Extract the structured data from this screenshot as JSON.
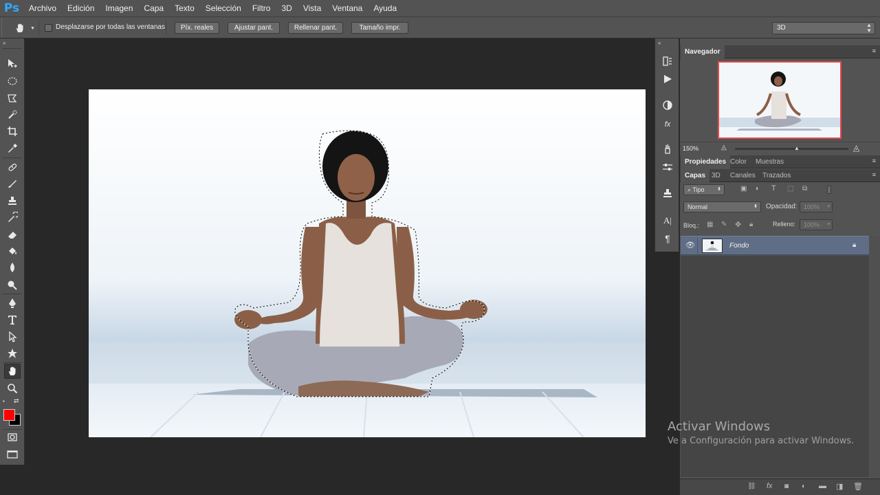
{
  "app": {
    "logo": "Ps"
  },
  "menu": [
    "Archivo",
    "Edición",
    "Imagen",
    "Capa",
    "Texto",
    "Selección",
    "Filtro",
    "3D",
    "Vista",
    "Ventana",
    "Ayuda"
  ],
  "options": {
    "scroll_all_label": "Desplazarse por todas las ventanas",
    "buttons": [
      "Píx. reales",
      "Ajustar pant.",
      "Rellenar pant.",
      "Tamaño impr."
    ],
    "workspace": "3D"
  },
  "tools": [
    "move-tool",
    "marquee-tool",
    "lasso-tool",
    "quick-selection-tool",
    "crop-tool",
    "eyedropper-tool",
    "healing-brush-tool",
    "brush-tool",
    "clone-stamp-tool",
    "history-brush-tool",
    "eraser-tool",
    "paint-bucket-tool",
    "blur-tool",
    "dodge-tool",
    "pen-tool",
    "type-tool",
    "path-selection-tool",
    "custom-shape-tool",
    "hand-tool",
    "zoom-tool"
  ],
  "colors": {
    "foreground": "#ff0000",
    "background": "#000000",
    "layer_highlight": "#5f6e86"
  },
  "navigator": {
    "title": "Navegador",
    "zoom": "150%"
  },
  "properties_tabs": [
    "Propiedades",
    "Color",
    "Muestras"
  ],
  "layers_tabs": [
    "Capas",
    "3D",
    "Canales",
    "Trazados"
  ],
  "layers": {
    "filter_kind": "Tipo",
    "blend_mode": "Normal",
    "opacity_label": "Opacidad:",
    "opacity_value": "100%",
    "lock_label": "Bloq.:",
    "fill_label": "Relleno:",
    "fill_value": "100%",
    "items": [
      {
        "name": "Fondo",
        "locked": true,
        "visible": true
      }
    ]
  },
  "watermark": {
    "title": "Activar Windows",
    "subtitle": "Ve a Configuración para activar Windows."
  }
}
